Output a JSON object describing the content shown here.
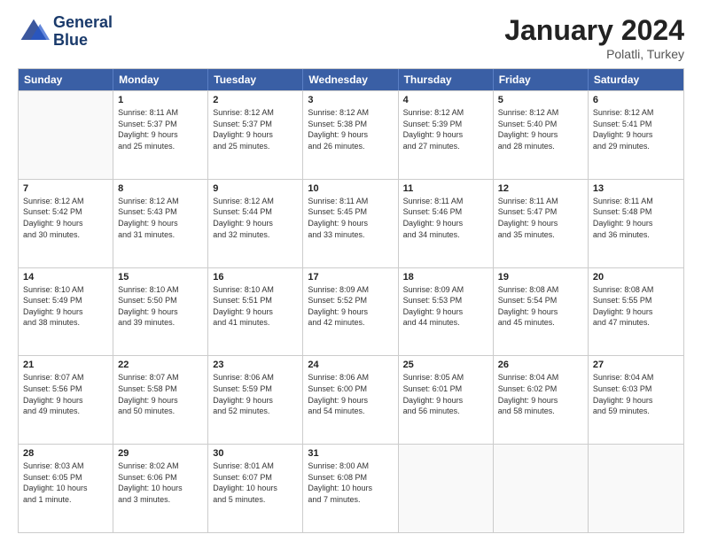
{
  "logo": {
    "line1": "General",
    "line2": "Blue"
  },
  "title": "January 2024",
  "subtitle": "Polatli, Turkey",
  "header_days": [
    "Sunday",
    "Monday",
    "Tuesday",
    "Wednesday",
    "Thursday",
    "Friday",
    "Saturday"
  ],
  "rows": [
    [
      {
        "day": "",
        "content": ""
      },
      {
        "day": "1",
        "content": "Sunrise: 8:11 AM\nSunset: 5:37 PM\nDaylight: 9 hours\nand 25 minutes."
      },
      {
        "day": "2",
        "content": "Sunrise: 8:12 AM\nSunset: 5:37 PM\nDaylight: 9 hours\nand 25 minutes."
      },
      {
        "day": "3",
        "content": "Sunrise: 8:12 AM\nSunset: 5:38 PM\nDaylight: 9 hours\nand 26 minutes."
      },
      {
        "day": "4",
        "content": "Sunrise: 8:12 AM\nSunset: 5:39 PM\nDaylight: 9 hours\nand 27 minutes."
      },
      {
        "day": "5",
        "content": "Sunrise: 8:12 AM\nSunset: 5:40 PM\nDaylight: 9 hours\nand 28 minutes."
      },
      {
        "day": "6",
        "content": "Sunrise: 8:12 AM\nSunset: 5:41 PM\nDaylight: 9 hours\nand 29 minutes."
      }
    ],
    [
      {
        "day": "7",
        "content": "Sunrise: 8:12 AM\nSunset: 5:42 PM\nDaylight: 9 hours\nand 30 minutes."
      },
      {
        "day": "8",
        "content": "Sunrise: 8:12 AM\nSunset: 5:43 PM\nDaylight: 9 hours\nand 31 minutes."
      },
      {
        "day": "9",
        "content": "Sunrise: 8:12 AM\nSunset: 5:44 PM\nDaylight: 9 hours\nand 32 minutes."
      },
      {
        "day": "10",
        "content": "Sunrise: 8:11 AM\nSunset: 5:45 PM\nDaylight: 9 hours\nand 33 minutes."
      },
      {
        "day": "11",
        "content": "Sunrise: 8:11 AM\nSunset: 5:46 PM\nDaylight: 9 hours\nand 34 minutes."
      },
      {
        "day": "12",
        "content": "Sunrise: 8:11 AM\nSunset: 5:47 PM\nDaylight: 9 hours\nand 35 minutes."
      },
      {
        "day": "13",
        "content": "Sunrise: 8:11 AM\nSunset: 5:48 PM\nDaylight: 9 hours\nand 36 minutes."
      }
    ],
    [
      {
        "day": "14",
        "content": "Sunrise: 8:10 AM\nSunset: 5:49 PM\nDaylight: 9 hours\nand 38 minutes."
      },
      {
        "day": "15",
        "content": "Sunrise: 8:10 AM\nSunset: 5:50 PM\nDaylight: 9 hours\nand 39 minutes."
      },
      {
        "day": "16",
        "content": "Sunrise: 8:10 AM\nSunset: 5:51 PM\nDaylight: 9 hours\nand 41 minutes."
      },
      {
        "day": "17",
        "content": "Sunrise: 8:09 AM\nSunset: 5:52 PM\nDaylight: 9 hours\nand 42 minutes."
      },
      {
        "day": "18",
        "content": "Sunrise: 8:09 AM\nSunset: 5:53 PM\nDaylight: 9 hours\nand 44 minutes."
      },
      {
        "day": "19",
        "content": "Sunrise: 8:08 AM\nSunset: 5:54 PM\nDaylight: 9 hours\nand 45 minutes."
      },
      {
        "day": "20",
        "content": "Sunrise: 8:08 AM\nSunset: 5:55 PM\nDaylight: 9 hours\nand 47 minutes."
      }
    ],
    [
      {
        "day": "21",
        "content": "Sunrise: 8:07 AM\nSunset: 5:56 PM\nDaylight: 9 hours\nand 49 minutes."
      },
      {
        "day": "22",
        "content": "Sunrise: 8:07 AM\nSunset: 5:58 PM\nDaylight: 9 hours\nand 50 minutes."
      },
      {
        "day": "23",
        "content": "Sunrise: 8:06 AM\nSunset: 5:59 PM\nDaylight: 9 hours\nand 52 minutes."
      },
      {
        "day": "24",
        "content": "Sunrise: 8:06 AM\nSunset: 6:00 PM\nDaylight: 9 hours\nand 54 minutes."
      },
      {
        "day": "25",
        "content": "Sunrise: 8:05 AM\nSunset: 6:01 PM\nDaylight: 9 hours\nand 56 minutes."
      },
      {
        "day": "26",
        "content": "Sunrise: 8:04 AM\nSunset: 6:02 PM\nDaylight: 9 hours\nand 58 minutes."
      },
      {
        "day": "27",
        "content": "Sunrise: 8:04 AM\nSunset: 6:03 PM\nDaylight: 9 hours\nand 59 minutes."
      }
    ],
    [
      {
        "day": "28",
        "content": "Sunrise: 8:03 AM\nSunset: 6:05 PM\nDaylight: 10 hours\nand 1 minute."
      },
      {
        "day": "29",
        "content": "Sunrise: 8:02 AM\nSunset: 6:06 PM\nDaylight: 10 hours\nand 3 minutes."
      },
      {
        "day": "30",
        "content": "Sunrise: 8:01 AM\nSunset: 6:07 PM\nDaylight: 10 hours\nand 5 minutes."
      },
      {
        "day": "31",
        "content": "Sunrise: 8:00 AM\nSunset: 6:08 PM\nDaylight: 10 hours\nand 7 minutes."
      },
      {
        "day": "",
        "content": ""
      },
      {
        "day": "",
        "content": ""
      },
      {
        "day": "",
        "content": ""
      }
    ]
  ]
}
